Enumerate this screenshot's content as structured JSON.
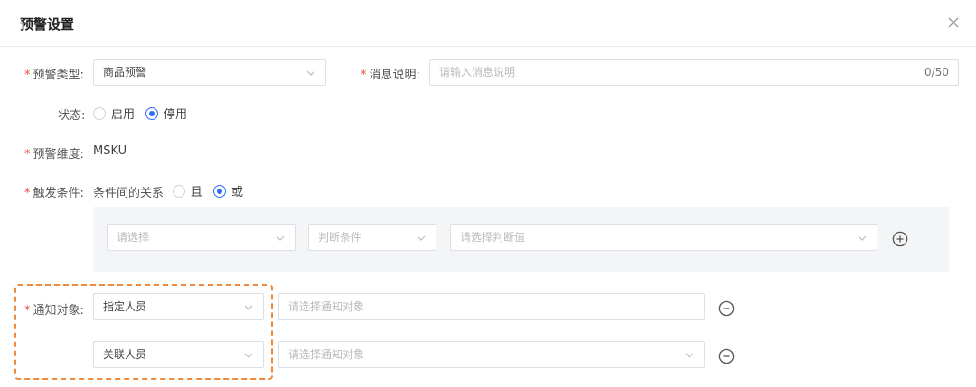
{
  "dialog": {
    "title": "预警设置"
  },
  "form": {
    "alert_type": {
      "label": "预警类型:",
      "value": "商品预警"
    },
    "message": {
      "label": "消息说明:",
      "placeholder": "请输入消息说明",
      "counter": "0/50"
    },
    "status": {
      "label": "状态:",
      "options": [
        "启用",
        "停用"
      ],
      "selected": "停用"
    },
    "dimension": {
      "label": "预警维度:",
      "value": "MSKU"
    },
    "trigger": {
      "label": "触发条件:",
      "relation_text": "条件间的关系",
      "options": [
        "且",
        "或"
      ],
      "selected": "或",
      "row": {
        "field_placeholder": "请选择",
        "operator_placeholder": "判断条件",
        "value_placeholder": "请选择判断值"
      }
    },
    "notify": {
      "label": "通知对象:",
      "rows": [
        {
          "type": "指定人员",
          "target_placeholder": "请选择通知对象"
        },
        {
          "type": "关联人员",
          "target_placeholder": "请选择通知对象"
        }
      ]
    }
  },
  "icons": {
    "close": "close-icon",
    "chevron": "chevron-down-icon",
    "add": "plus-circle-icon",
    "remove": "minus-circle-icon"
  },
  "colors": {
    "accent": "#2d6cf6",
    "required": "#e84d3d",
    "highlight": "#f08a3a"
  }
}
